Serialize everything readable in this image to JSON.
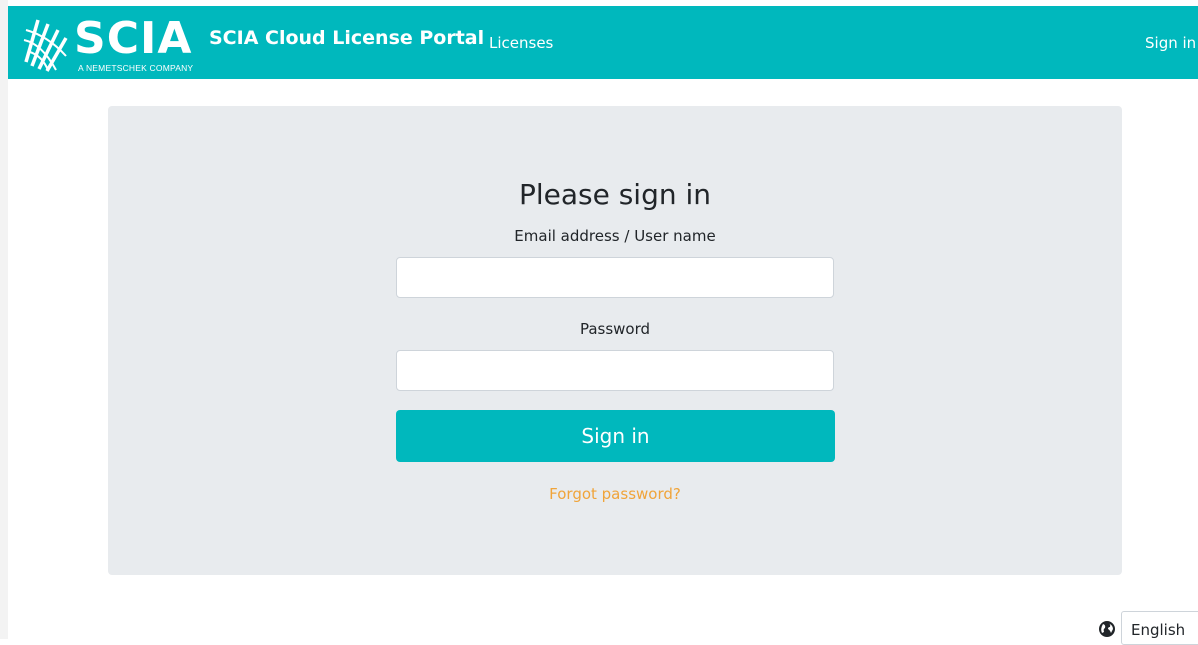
{
  "header": {
    "logo_text": "SCIA",
    "logo_subtitle": "A NEMETSCHEK COMPANY",
    "brand_title": "SCIA Cloud License Portal",
    "nav_licenses": "Licenses",
    "nav_sign_in": "Sign in"
  },
  "form": {
    "heading": "Please sign in",
    "email_label": "Email address / User name",
    "email_value": "",
    "password_label": "Password",
    "password_value": "",
    "submit_label": "Sign in",
    "forgot_link": "Forgot password?"
  },
  "footer": {
    "language_icon": "globe-icon",
    "language_selected": "English"
  },
  "colors": {
    "brand": "#00b8bd",
    "card_bg": "#e8ebee",
    "link_orange": "#f0a43a"
  }
}
